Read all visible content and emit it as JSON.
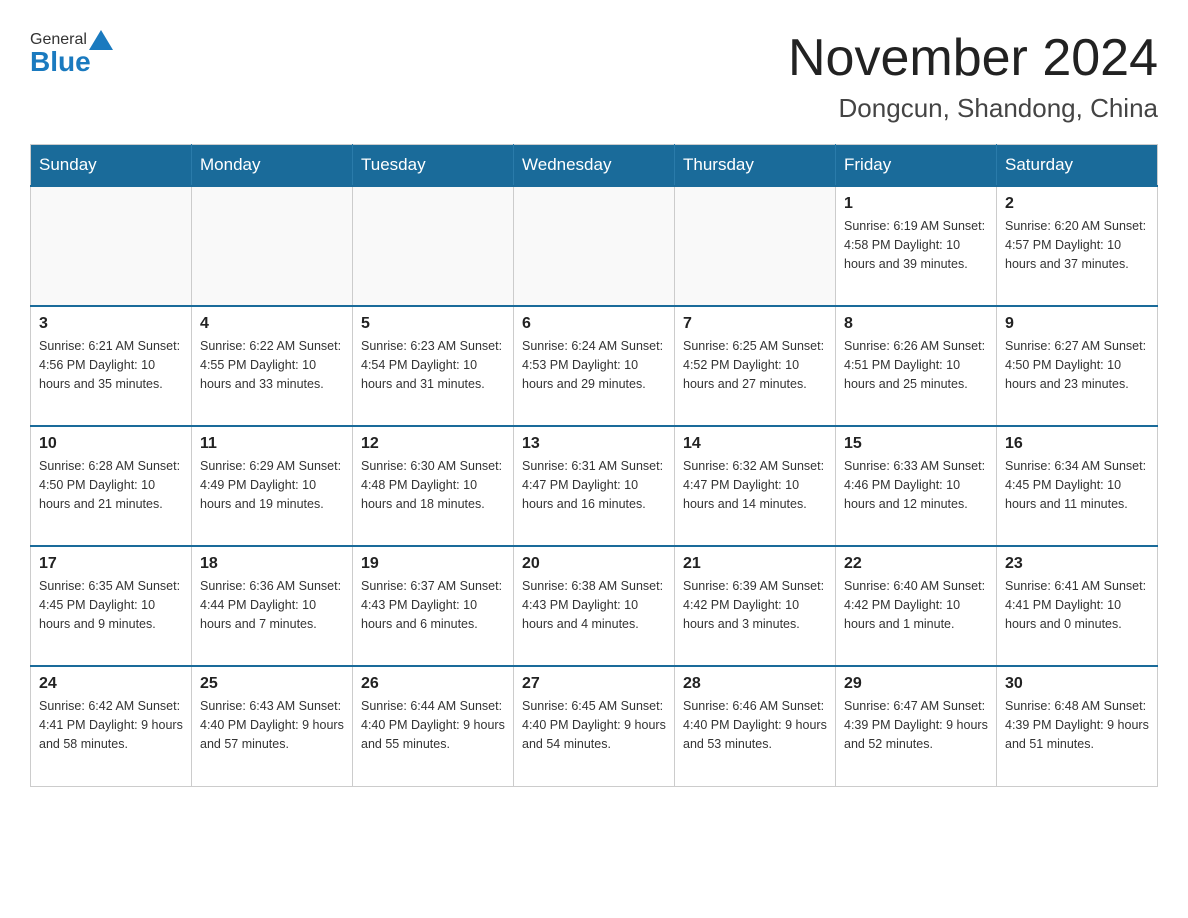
{
  "header": {
    "logo": {
      "part1": "General",
      "part2": "Blue"
    },
    "title": "November 2024",
    "location": "Dongcun, Shandong, China"
  },
  "weekdays": [
    "Sunday",
    "Monday",
    "Tuesday",
    "Wednesday",
    "Thursday",
    "Friday",
    "Saturday"
  ],
  "weeks": [
    [
      {
        "day": "",
        "info": ""
      },
      {
        "day": "",
        "info": ""
      },
      {
        "day": "",
        "info": ""
      },
      {
        "day": "",
        "info": ""
      },
      {
        "day": "",
        "info": ""
      },
      {
        "day": "1",
        "info": "Sunrise: 6:19 AM\nSunset: 4:58 PM\nDaylight: 10 hours\nand 39 minutes."
      },
      {
        "day": "2",
        "info": "Sunrise: 6:20 AM\nSunset: 4:57 PM\nDaylight: 10 hours\nand 37 minutes."
      }
    ],
    [
      {
        "day": "3",
        "info": "Sunrise: 6:21 AM\nSunset: 4:56 PM\nDaylight: 10 hours\nand 35 minutes."
      },
      {
        "day": "4",
        "info": "Sunrise: 6:22 AM\nSunset: 4:55 PM\nDaylight: 10 hours\nand 33 minutes."
      },
      {
        "day": "5",
        "info": "Sunrise: 6:23 AM\nSunset: 4:54 PM\nDaylight: 10 hours\nand 31 minutes."
      },
      {
        "day": "6",
        "info": "Sunrise: 6:24 AM\nSunset: 4:53 PM\nDaylight: 10 hours\nand 29 minutes."
      },
      {
        "day": "7",
        "info": "Sunrise: 6:25 AM\nSunset: 4:52 PM\nDaylight: 10 hours\nand 27 minutes."
      },
      {
        "day": "8",
        "info": "Sunrise: 6:26 AM\nSunset: 4:51 PM\nDaylight: 10 hours\nand 25 minutes."
      },
      {
        "day": "9",
        "info": "Sunrise: 6:27 AM\nSunset: 4:50 PM\nDaylight: 10 hours\nand 23 minutes."
      }
    ],
    [
      {
        "day": "10",
        "info": "Sunrise: 6:28 AM\nSunset: 4:50 PM\nDaylight: 10 hours\nand 21 minutes."
      },
      {
        "day": "11",
        "info": "Sunrise: 6:29 AM\nSunset: 4:49 PM\nDaylight: 10 hours\nand 19 minutes."
      },
      {
        "day": "12",
        "info": "Sunrise: 6:30 AM\nSunset: 4:48 PM\nDaylight: 10 hours\nand 18 minutes."
      },
      {
        "day": "13",
        "info": "Sunrise: 6:31 AM\nSunset: 4:47 PM\nDaylight: 10 hours\nand 16 minutes."
      },
      {
        "day": "14",
        "info": "Sunrise: 6:32 AM\nSunset: 4:47 PM\nDaylight: 10 hours\nand 14 minutes."
      },
      {
        "day": "15",
        "info": "Sunrise: 6:33 AM\nSunset: 4:46 PM\nDaylight: 10 hours\nand 12 minutes."
      },
      {
        "day": "16",
        "info": "Sunrise: 6:34 AM\nSunset: 4:45 PM\nDaylight: 10 hours\nand 11 minutes."
      }
    ],
    [
      {
        "day": "17",
        "info": "Sunrise: 6:35 AM\nSunset: 4:45 PM\nDaylight: 10 hours\nand 9 minutes."
      },
      {
        "day": "18",
        "info": "Sunrise: 6:36 AM\nSunset: 4:44 PM\nDaylight: 10 hours\nand 7 minutes."
      },
      {
        "day": "19",
        "info": "Sunrise: 6:37 AM\nSunset: 4:43 PM\nDaylight: 10 hours\nand 6 minutes."
      },
      {
        "day": "20",
        "info": "Sunrise: 6:38 AM\nSunset: 4:43 PM\nDaylight: 10 hours\nand 4 minutes."
      },
      {
        "day": "21",
        "info": "Sunrise: 6:39 AM\nSunset: 4:42 PM\nDaylight: 10 hours\nand 3 minutes."
      },
      {
        "day": "22",
        "info": "Sunrise: 6:40 AM\nSunset: 4:42 PM\nDaylight: 10 hours\nand 1 minute."
      },
      {
        "day": "23",
        "info": "Sunrise: 6:41 AM\nSunset: 4:41 PM\nDaylight: 10 hours\nand 0 minutes."
      }
    ],
    [
      {
        "day": "24",
        "info": "Sunrise: 6:42 AM\nSunset: 4:41 PM\nDaylight: 9 hours\nand 58 minutes."
      },
      {
        "day": "25",
        "info": "Sunrise: 6:43 AM\nSunset: 4:40 PM\nDaylight: 9 hours\nand 57 minutes."
      },
      {
        "day": "26",
        "info": "Sunrise: 6:44 AM\nSunset: 4:40 PM\nDaylight: 9 hours\nand 55 minutes."
      },
      {
        "day": "27",
        "info": "Sunrise: 6:45 AM\nSunset: 4:40 PM\nDaylight: 9 hours\nand 54 minutes."
      },
      {
        "day": "28",
        "info": "Sunrise: 6:46 AM\nSunset: 4:40 PM\nDaylight: 9 hours\nand 53 minutes."
      },
      {
        "day": "29",
        "info": "Sunrise: 6:47 AM\nSunset: 4:39 PM\nDaylight: 9 hours\nand 52 minutes."
      },
      {
        "day": "30",
        "info": "Sunrise: 6:48 AM\nSunset: 4:39 PM\nDaylight: 9 hours\nand 51 minutes."
      }
    ]
  ]
}
